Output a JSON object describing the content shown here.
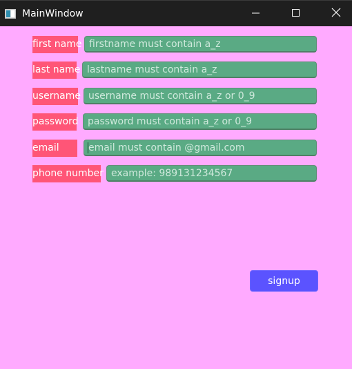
{
  "window": {
    "title": "MainWindow",
    "icon": "app-window-icon",
    "controls": {
      "minimize": "minimize-icon",
      "maximize": "maximize-icon",
      "close": "close-icon"
    }
  },
  "form": {
    "fields": [
      {
        "label": "first name",
        "placeholder": "firstname must contain a_z",
        "value": ""
      },
      {
        "label": "last name",
        "placeholder": "lastname must contain a_z",
        "value": ""
      },
      {
        "label": "username",
        "placeholder": "username must contain a_z or 0_9",
        "value": ""
      },
      {
        "label": "password",
        "placeholder": "password must contain a_z or 0_9",
        "value": ""
      },
      {
        "label": "email",
        "placeholder": "email must contain @gmail.com",
        "value": ""
      },
      {
        "label": "phone number",
        "placeholder": "example: 989131234567",
        "value": ""
      }
    ],
    "signup_label": "signup"
  },
  "colors": {
    "window_background": "#ffaaff",
    "label_background": "#ff5577",
    "field_background": "#5aaa84",
    "button_background": "#5b53ff",
    "titlebar_background": "#1f1f1f"
  }
}
